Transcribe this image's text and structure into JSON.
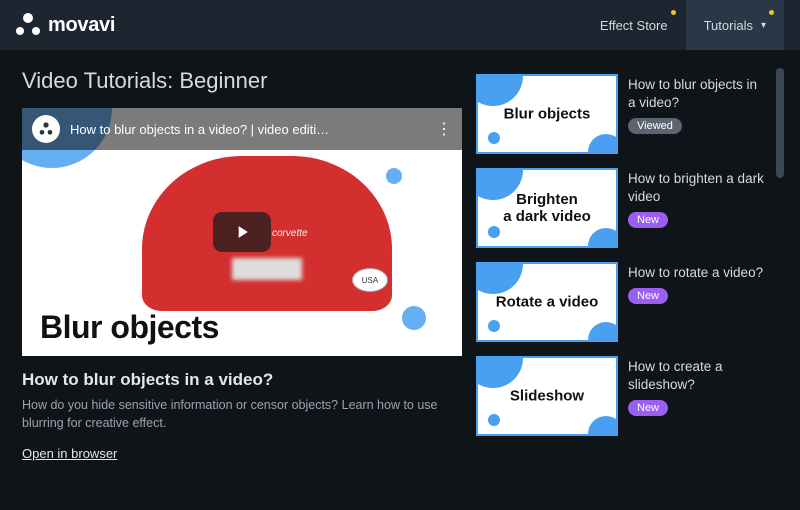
{
  "brand": "movavi",
  "nav": {
    "effect_store": "Effect Store",
    "tutorials": "Tutorials"
  },
  "page_title": "Video Tutorials: Beginner",
  "video": {
    "topbar_title": "How to blur objects in a video? | video editi…",
    "caption": "Blur objects",
    "car_brand": "corvette",
    "sticker": "USA"
  },
  "featured": {
    "title": "How to blur objects in a video?",
    "desc": "How do you hide sensitive information or censor objects? Learn how to use blurring for creative effect.",
    "open": "Open in browser"
  },
  "list": [
    {
      "thumb": "Blur objects",
      "title": "How to blur objects in a video?",
      "badge": "Viewed",
      "badge_kind": "viewed"
    },
    {
      "thumb": "Brighten\na dark video",
      "title": "How to brighten a dark video",
      "badge": "New",
      "badge_kind": "new"
    },
    {
      "thumb": "Rotate a video",
      "title": "How to rotate a video?",
      "badge": "New",
      "badge_kind": "new"
    },
    {
      "thumb": "Slideshow",
      "title": "How to create a slideshow?",
      "badge": "New",
      "badge_kind": "new"
    }
  ]
}
